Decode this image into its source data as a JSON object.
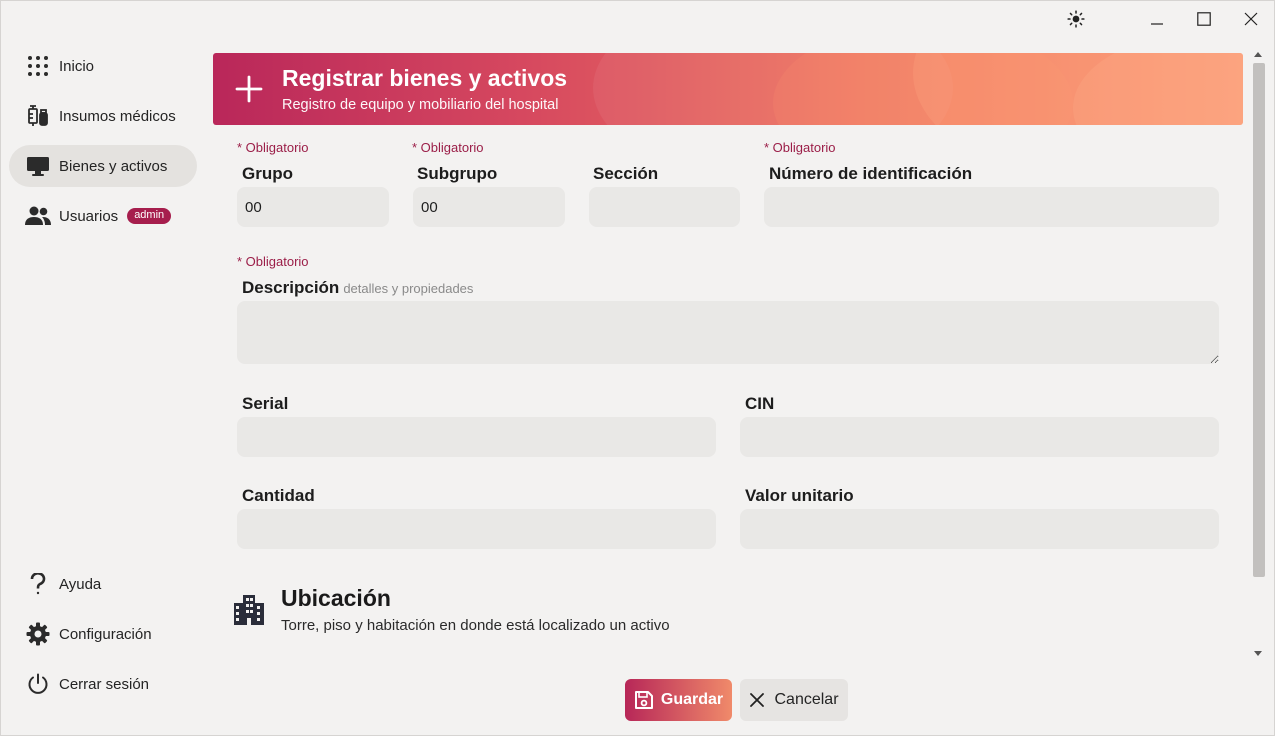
{
  "window": {
    "theme_toggle_icon": "sun-icon",
    "minimize_icon": "minimize-icon",
    "maximize_icon": "maximize-icon",
    "close_icon": "close-icon"
  },
  "sidebar": {
    "top_items": [
      {
        "label": "Inicio",
        "icon": "grid-dots-icon"
      },
      {
        "label": "Insumos médicos",
        "icon": "medical-supplies-icon"
      },
      {
        "label": "Bienes y activos",
        "icon": "monitor-icon",
        "active": true
      },
      {
        "label": "Usuarios",
        "icon": "users-icon",
        "badge": "admin"
      }
    ],
    "bottom_items": [
      {
        "label": "Ayuda",
        "icon": "help-icon"
      },
      {
        "label": "Configuración",
        "icon": "gear-icon"
      },
      {
        "label": "Cerrar sesión",
        "icon": "power-icon"
      }
    ]
  },
  "banner": {
    "icon": "plus-icon",
    "title": "Registrar bienes y activos",
    "subtitle": "Registro de equipo y mobiliario del hospital"
  },
  "form": {
    "required_text": "* Obligatorio",
    "grupo": {
      "label": "Grupo",
      "value": "00"
    },
    "subgrupo": {
      "label": "Subgrupo",
      "value": "00"
    },
    "seccion": {
      "label": "Sección",
      "value": ""
    },
    "numero": {
      "label": "Número de identificación",
      "value": ""
    },
    "descripcion": {
      "label": "Descripción",
      "hint": "detalles y propiedades",
      "value": ""
    },
    "serial": {
      "label": "Serial",
      "value": ""
    },
    "cin": {
      "label": "CIN",
      "value": ""
    },
    "cantidad": {
      "label": "Cantidad",
      "value": ""
    },
    "valor": {
      "label": "Valor unitario",
      "value": ""
    }
  },
  "location_section": {
    "icon": "building-icon",
    "title": "Ubicación",
    "subtitle": "Torre, piso y habitación en donde está localizado un activo"
  },
  "actions": {
    "save_label": "Guardar",
    "save_icon": "save-icon",
    "cancel_label": "Cancelar",
    "cancel_icon": "close-icon"
  },
  "colors": {
    "accent": "#a61e4d",
    "banner_start": "#b9275a",
    "banner_end": "#fb9b78"
  }
}
